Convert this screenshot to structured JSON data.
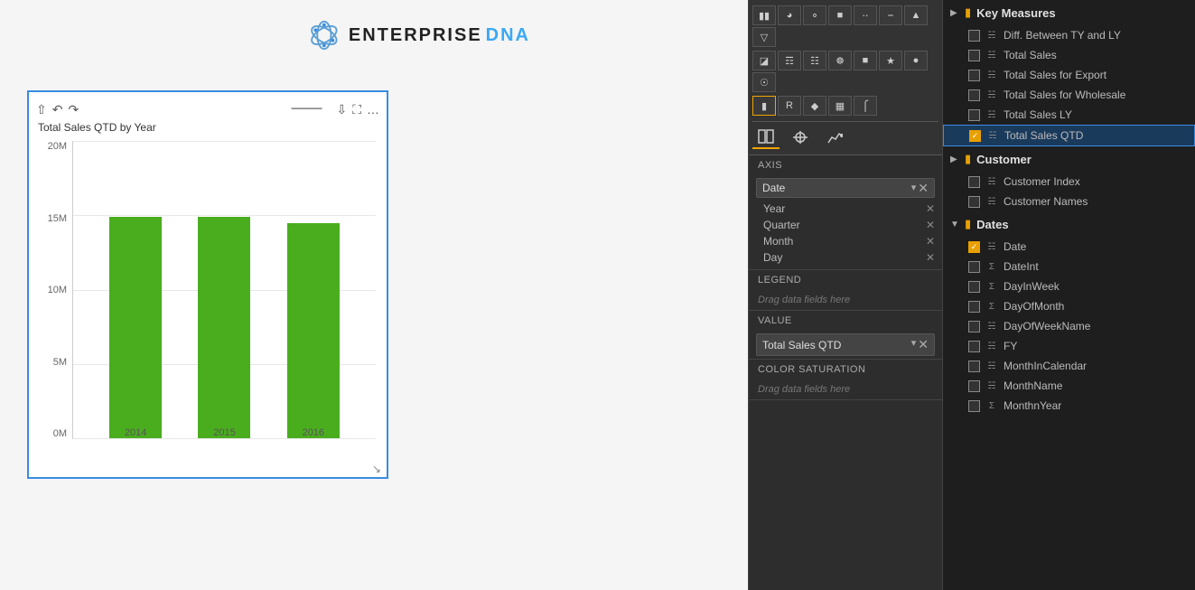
{
  "logo": {
    "brand": "ENTERPRISE",
    "brand_colored": "DNA"
  },
  "chart": {
    "title": "Total Sales QTD by Year",
    "y_labels": [
      "20M",
      "15M",
      "10M",
      "5M",
      "0M"
    ],
    "bars": [
      {
        "year": "2014",
        "height_pct": 76
      },
      {
        "year": "2015",
        "height_pct": 76
      },
      {
        "year": "2016",
        "height_pct": 74
      }
    ]
  },
  "middle_panel": {
    "axis_label": "Axis",
    "axis_chip_label": "Date",
    "axis_items": [
      {
        "label": "Year",
        "removable": true
      },
      {
        "label": "Quarter",
        "removable": true
      },
      {
        "label": "Month",
        "removable": true
      },
      {
        "label": "Day",
        "removable": true
      }
    ],
    "legend_label": "Legend",
    "legend_placeholder": "Drag data fields here",
    "value_label": "Value",
    "value_chip_label": "Total Sales QTD",
    "color_saturation_label": "Color saturation",
    "color_saturation_placeholder": "Drag data fields here"
  },
  "right_panel": {
    "sections": [
      {
        "id": "key-measures",
        "label": "Key Measures",
        "expanded": true,
        "items": [
          {
            "id": "diff-ty-ly",
            "label": "Diff. Between TY and LY",
            "type": "table",
            "checked": false
          },
          {
            "id": "total-sales",
            "label": "Total Sales",
            "type": "table",
            "checked": false
          },
          {
            "id": "total-sales-export",
            "label": "Total Sales for Export",
            "type": "table",
            "checked": false
          },
          {
            "id": "total-sales-wholesale",
            "label": "Total Sales for Wholesale",
            "type": "table",
            "checked": false
          },
          {
            "id": "total-sales-ly",
            "label": "Total Sales LY",
            "type": "table",
            "checked": false
          },
          {
            "id": "total-sales-qtd",
            "label": "Total Sales QTD",
            "type": "table",
            "checked": true,
            "selected": true
          }
        ]
      },
      {
        "id": "customer",
        "label": "Customer",
        "expanded": true,
        "items": [
          {
            "id": "customer-index",
            "label": "Customer Index",
            "type": "table",
            "checked": false
          },
          {
            "id": "customer-names",
            "label": "Customer Names",
            "type": "table",
            "checked": false
          }
        ]
      },
      {
        "id": "dates",
        "label": "Dates",
        "expanded": true,
        "items": [
          {
            "id": "date",
            "label": "Date",
            "type": "table",
            "checked": true
          },
          {
            "id": "dateint",
            "label": "DateInt",
            "type": "sigma",
            "checked": false
          },
          {
            "id": "dayinweek",
            "label": "DayInWeek",
            "type": "sigma",
            "checked": false
          },
          {
            "id": "dayofmonth",
            "label": "DayOfMonth",
            "type": "sigma",
            "checked": false
          },
          {
            "id": "dayofweekname",
            "label": "DayOfWeekName",
            "type": "table",
            "checked": false
          },
          {
            "id": "fy",
            "label": "FY",
            "type": "table",
            "checked": false
          },
          {
            "id": "monthincalendar",
            "label": "MonthInCalendar",
            "type": "table",
            "checked": false
          },
          {
            "id": "monthname",
            "label": "MonthName",
            "type": "table",
            "checked": false
          },
          {
            "id": "monthnyear",
            "label": "MonthnYear",
            "type": "sigma",
            "checked": false
          }
        ]
      }
    ]
  }
}
